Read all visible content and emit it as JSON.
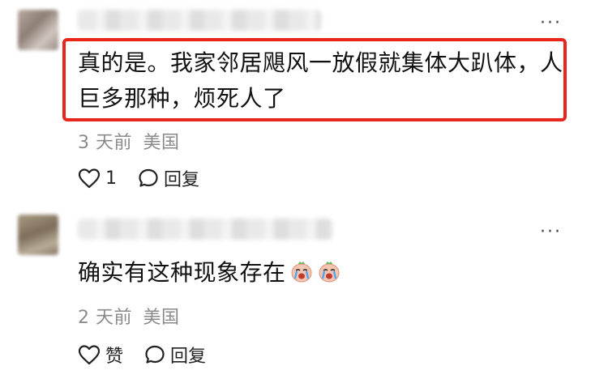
{
  "comments": [
    {
      "text_line1": "真的是。我家邻居飓风一放假就集体大趴体，人",
      "text_line2": "巨多那种，烦死人了",
      "time": "3 天前",
      "location": "美国",
      "like_count": "1",
      "reply_label": "回复",
      "highlight_color": "#e8261d"
    },
    {
      "text": "确实有这种现象存在",
      "emojis": [
        "crying-face-emoji",
        "crying-face-emoji"
      ],
      "time": "2 天前",
      "location": "美国",
      "like_label": "赞",
      "reply_label": "回复"
    }
  ],
  "more_glyph": "···"
}
